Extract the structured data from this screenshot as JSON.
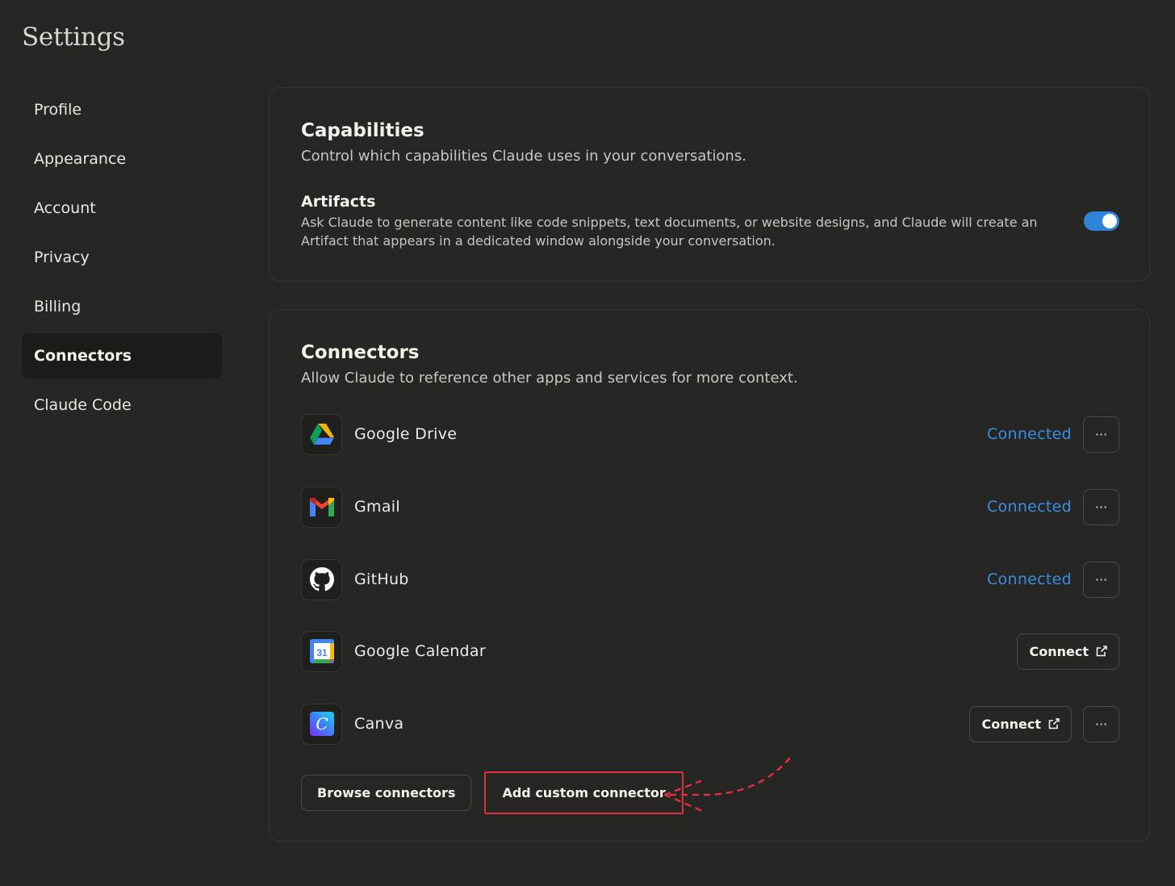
{
  "page": {
    "title": "Settings"
  },
  "sidebar": {
    "items": [
      {
        "label": "Profile"
      },
      {
        "label": "Appearance"
      },
      {
        "label": "Account"
      },
      {
        "label": "Privacy"
      },
      {
        "label": "Billing"
      },
      {
        "label": "Connectors",
        "active": true
      },
      {
        "label": "Claude Code"
      }
    ]
  },
  "capabilities": {
    "title": "Capabilities",
    "subtitle": "Control which capabilities Claude uses in your conversations.",
    "artifacts": {
      "title": "Artifacts",
      "description": "Ask Claude to generate content like code snippets, text documents, or website designs, and Claude will create an Artifact that appears in a dedicated window alongside your conversation.",
      "enabled": true
    }
  },
  "connectors": {
    "title": "Connectors",
    "subtitle": "Allow Claude to reference other apps and services for more context.",
    "items": [
      {
        "name": "Google Drive",
        "icon": "google-drive-icon",
        "status": "Connected"
      },
      {
        "name": "Gmail",
        "icon": "gmail-icon",
        "status": "Connected"
      },
      {
        "name": "GitHub",
        "icon": "github-icon",
        "status": "Connected"
      },
      {
        "name": "Google Calendar",
        "icon": "google-calendar-icon",
        "connect_label": "Connect",
        "calendar_day": "31"
      },
      {
        "name": "Canva",
        "icon": "canva-icon",
        "connect_label": "Connect",
        "logo_letter": "C"
      }
    ],
    "more_label": "···",
    "browse_label": "Browse connectors",
    "add_custom_label": "Add custom connector"
  },
  "colors": {
    "accent_blue": "#2c84db",
    "connected_text": "#3a8ee0",
    "highlight_red": "#d9313d"
  }
}
